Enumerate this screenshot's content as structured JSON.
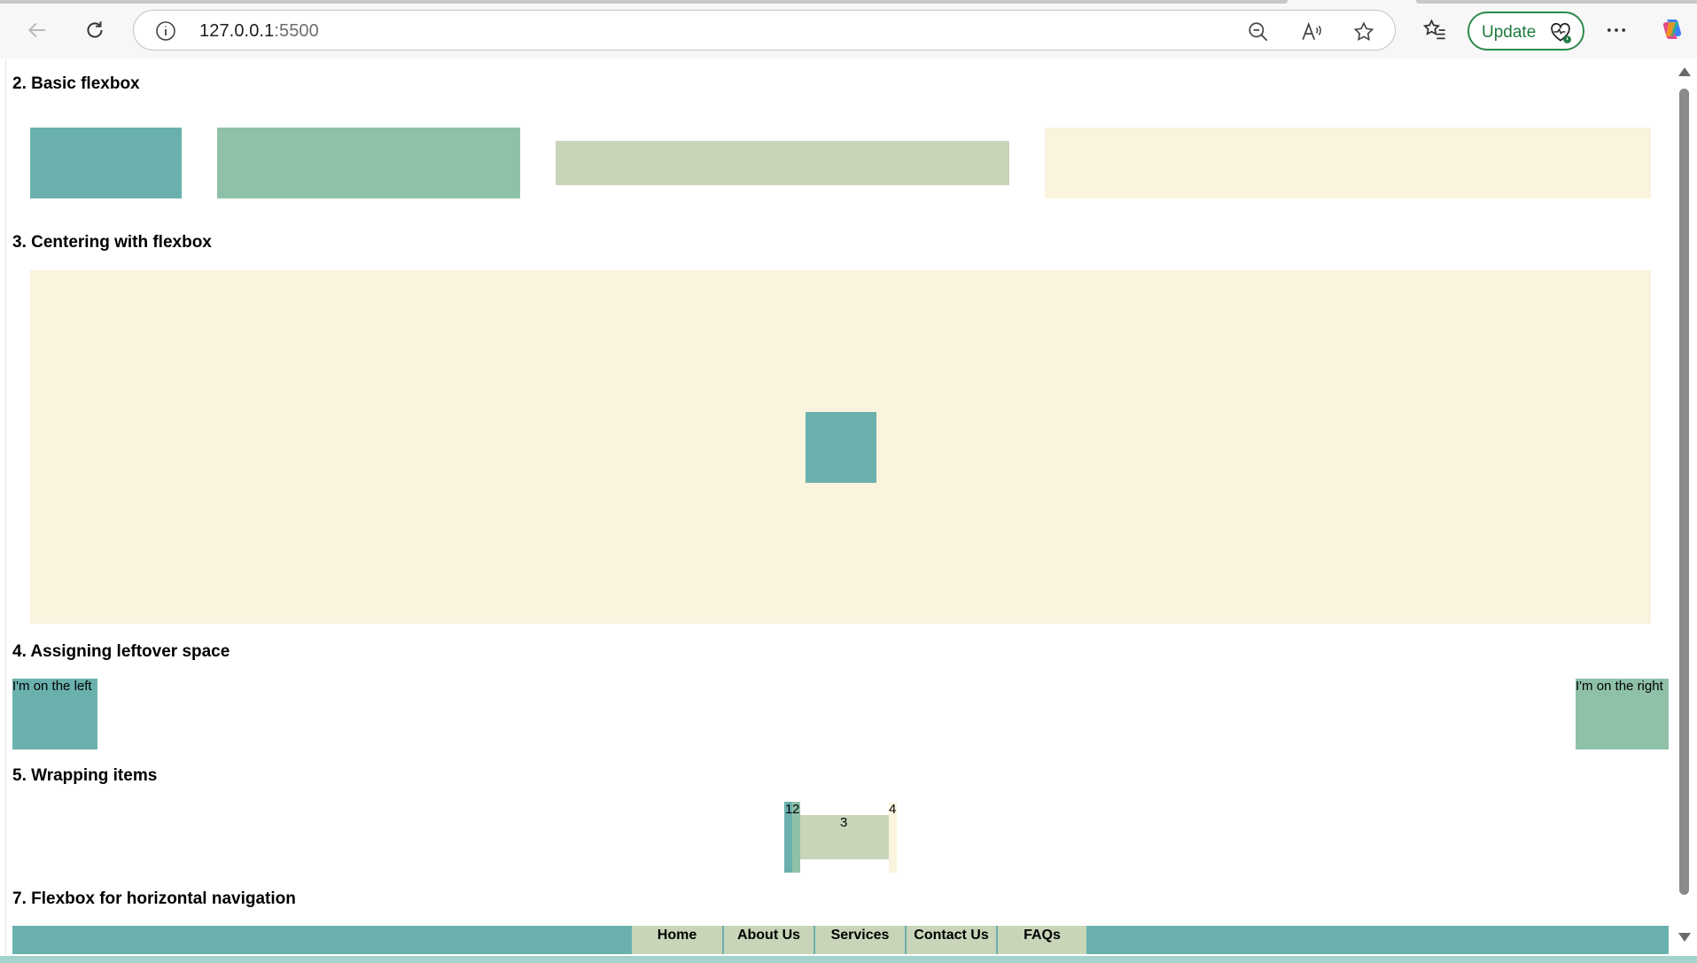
{
  "browser": {
    "url_host": "127.0.0.1",
    "url_port": ":5500",
    "update_label": "Update"
  },
  "sections": {
    "basic": "2. Basic flexbox",
    "centering": "3. Centering with flexbox",
    "leftover": "4. Assigning leftover space",
    "wrapping": "5. Wrapping items",
    "navigation": "7. Flexbox for horizontal navigation"
  },
  "leftover_items": {
    "left": "I'm on the left",
    "right": "I'm on the right"
  },
  "wrap_items": [
    "1",
    "2",
    "3",
    "4"
  ],
  "nav_items": [
    "Home",
    "About Us",
    "Services",
    "Contact Us",
    "FAQs"
  ],
  "colors": {
    "teal": "#6ab1ad",
    "sage": "#8fc1a9",
    "pale": "#c8d5b9",
    "cream": "#faf3dd"
  }
}
